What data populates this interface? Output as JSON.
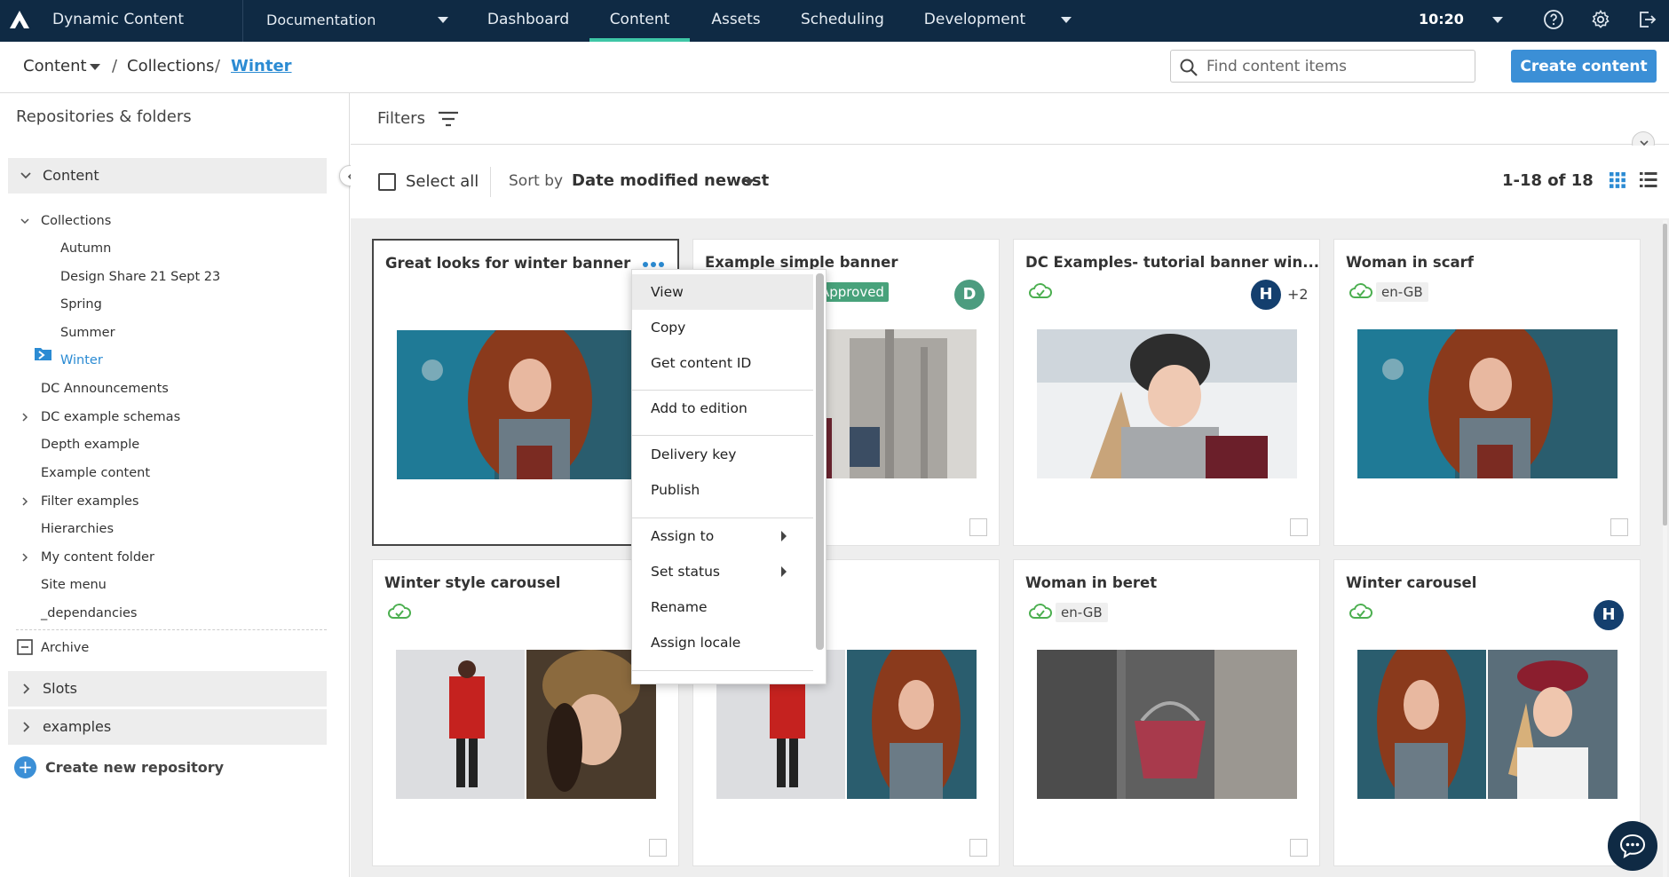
{
  "app": {
    "name": "Dynamic Content",
    "hub": "Documentation",
    "time": "10:20"
  },
  "nav": {
    "tabs": [
      "Dashboard",
      "Content",
      "Assets",
      "Scheduling",
      "Development"
    ],
    "active": "Content"
  },
  "breadcrumb": {
    "root": "Content",
    "mid": "Collections",
    "current": "Winter"
  },
  "search": {
    "placeholder": "Find content items"
  },
  "create_button": "Create content",
  "sidebar": {
    "title": "Repositories & folders",
    "content_repo": "Content",
    "tree": [
      "Collections",
      "Autumn",
      "Design Share 21 Sept 23",
      "Spring",
      "Summer",
      "Winter",
      "DC Announcements",
      "DC example schemas",
      "Depth example",
      "Example content",
      "Filter examples",
      "Hierarchies",
      "My content folder",
      "Site menu",
      "_dependancies"
    ],
    "archive": "Archive",
    "repos": [
      "Slots",
      "examples"
    ],
    "create_repo": "Create new repository"
  },
  "filters": {
    "label": "Filters"
  },
  "toolbar": {
    "select_all": "Select all",
    "sort_label": "Sort by",
    "sort_value": "Date modified newest",
    "count": "1-18 of 18"
  },
  "cards": [
    {
      "title": "Great looks for winter banner"
    },
    {
      "title": "Example simple banner",
      "status": "Approved",
      "avatar": "D"
    },
    {
      "title": "DC Examples- tutorial banner win...",
      "avatar": "H",
      "extra": "+2"
    },
    {
      "title": "Woman in scarf",
      "locale": "en-GB"
    },
    {
      "title": "Winter style carousel"
    },
    {
      "title": ""
    },
    {
      "title": "Woman in beret",
      "locale": "en-GB"
    },
    {
      "title": "Winter carousel",
      "avatar": "H"
    }
  ],
  "context_menu": [
    "View",
    "Copy",
    "Get content ID",
    "Add to edition",
    "Delivery key",
    "Publish",
    "Assign to",
    "Set status",
    "Rename",
    "Assign locale"
  ],
  "colors": {
    "nav_bg": "#0f2a44",
    "accent": "#3b8fd6",
    "active_tab": "#3ec6a6",
    "published": "#4caf50"
  }
}
